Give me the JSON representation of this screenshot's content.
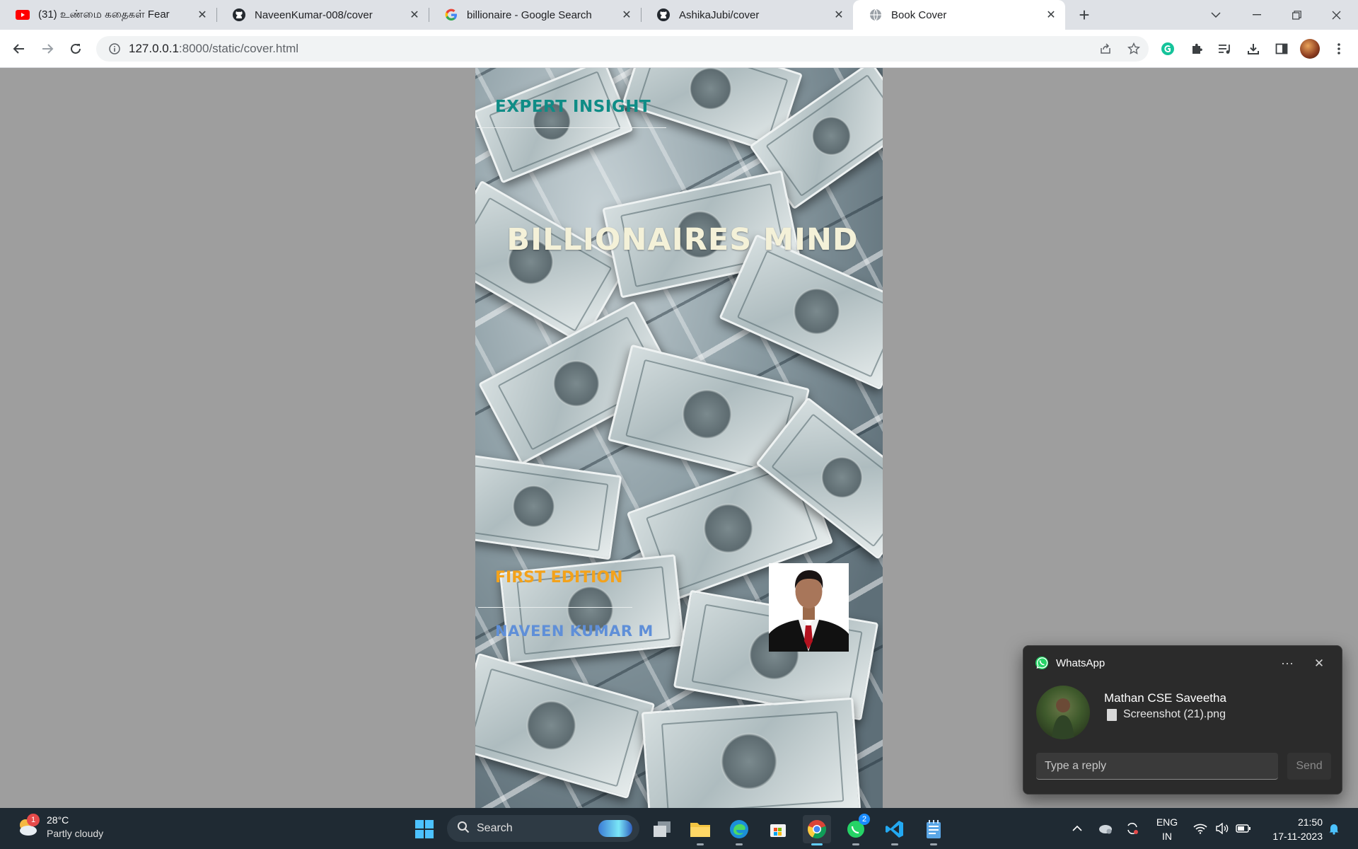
{
  "browser": {
    "tabs": [
      {
        "title": "(31) உண்மை கதைகள் Fear",
        "favicon": "youtube-icon",
        "active": false
      },
      {
        "title": "NaveenKumar-008/cover",
        "favicon": "github-icon",
        "active": false
      },
      {
        "title": "billionaire - Google Search",
        "favicon": "google-icon",
        "active": false
      },
      {
        "title": "AshikaJubi/cover",
        "favicon": "github-icon",
        "active": false
      },
      {
        "title": "Book Cover",
        "favicon": "globe-icon",
        "active": true
      }
    ],
    "url_host": "127.0.0.1",
    "url_rest": ":8000/static/cover.html"
  },
  "cover": {
    "top_label": "EXPERT INSIGHT",
    "title": "BILLIONAIRES MIND",
    "edition": "FIRST EDITION",
    "author": "NAVEEN KUMAR M",
    "colors": {
      "top_label": "#0f8c86",
      "title": "#f4f1d8",
      "edition": "#f3a21b",
      "author": "#5f8fd8"
    }
  },
  "notification": {
    "app": "WhatsApp",
    "sender": "Mathan CSE Saveetha",
    "file": "Screenshot (21).png",
    "reply_placeholder": "Type a reply",
    "send_label": "Send",
    "more_label": "···"
  },
  "taskbar": {
    "weather": {
      "badge": "1",
      "temp": "28°C",
      "condition": "Partly cloudy"
    },
    "search_label": "Search",
    "whatsapp_badge": "2",
    "lang_line1": "ENG",
    "lang_line2": "IN",
    "time": "21:50",
    "date": "17-11-2023"
  }
}
